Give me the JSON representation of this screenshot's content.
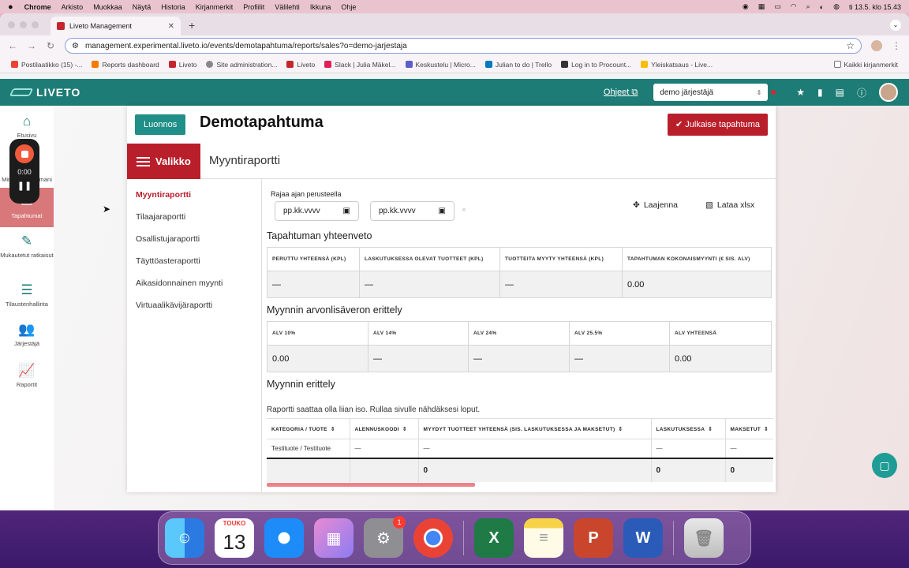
{
  "menubar": {
    "app": "Chrome",
    "items": [
      "Arkisto",
      "Muokkaa",
      "Näytä",
      "Historia",
      "Kirjanmerkit",
      "Profiilit",
      "Välilehti",
      "Ikkuna",
      "Ohje"
    ],
    "clock": "ti 13.5. klo 15.43"
  },
  "browser": {
    "tab_title": "Liveto Management",
    "url": "management.experimental.liveto.io/events/demotapahtuma/reports/sales?o=demo-jarjestaja",
    "bookmarks": [
      "Postilaatikko (15) -...",
      "Reports dashboard",
      "Liveto",
      "Site administration...",
      "Liveto",
      "Slack | Julia Mäkel...",
      "Keskustelu | Micro...",
      "Julian to do | Trello",
      "Log in to Procount...",
      "Yleiskatsaus - Live..."
    ],
    "bookmarks_all": "Kaikki kirjanmerkit"
  },
  "app": {
    "logo": "LIVETO",
    "help": "Ohjeet",
    "org_select": "demo järjestäjä",
    "sidebar": [
      {
        "label": "Etusivu",
        "icon": "home-icon"
      },
      {
        "label": "Minun tapahtumani",
        "icon": "calendar-icon"
      },
      {
        "label": "Tapahtumat",
        "icon": "tickets-icon"
      },
      {
        "label": "Mukautetut ratkaisut",
        "icon": "edit-icon"
      },
      {
        "label": "Tilaustenhallinta",
        "icon": "list-icon"
      },
      {
        "label": "Järjestäjä",
        "icon": "users-icon"
      },
      {
        "label": "Raportit",
        "icon": "chart-icon"
      }
    ],
    "recorder_time": "0:00"
  },
  "event": {
    "status": "Luonnos",
    "title": "Demotapahtuma",
    "publish": "Julkaise tapahtuma",
    "menu_button": "Valikko",
    "report_title": "Myyntiraportti"
  },
  "report_nav": [
    "Myyntiraportti",
    "Tilaajaraportti",
    "Osallistujaraportti",
    "Täyttöasteraportti",
    "Aikasidonnainen myynti",
    "Virtuaalikävijäraportti"
  ],
  "filters": {
    "label": "Rajaa ajan perusteella",
    "date_placeholder": "pp.kk.vvvv",
    "clear": "×",
    "expand": "Laajenna",
    "download": "Lataa xlsx"
  },
  "summary": {
    "title": "Tapahtuman yhteenveto",
    "headers": [
      "PERUTTU YHTEENSÄ (KPL)",
      "LASKUTUKSESSA OLEVAT TUOTTEET (KPL)",
      "TUOTTEITA MYYTY YHTEENSÄ (KPL)",
      "TAPAHTUMAN KOKONAISMYYNTI (€ SIS. ALV)"
    ],
    "values": [
      "—",
      "—",
      "—",
      "0.00"
    ]
  },
  "vat": {
    "title": "Myynnin arvonlisäveron erittely",
    "headers": [
      "ALV 10%",
      "ALV 14%",
      "ALV 24%",
      "ALV 25.5%",
      "ALV YHTEENSÄ"
    ],
    "values": [
      "0.00",
      "—",
      "—",
      "—",
      "0.00"
    ]
  },
  "sales": {
    "title": "Myynnin erittely",
    "note": "Raportti saattaa olla liian iso. Rullaa sivulle nähdäksesi loput.",
    "headers": [
      "KATEGORIA / TUOTE",
      "ALENNUSKOODI",
      "MYYDYT TUOTTEET YHTEENSÄ (SIS. LASKUTUKSESSA JA MAKSETUT)",
      "LASKUTUKSESSA",
      "MAKSETUT"
    ],
    "row": [
      "Testituote / Testituote",
      "—",
      "—",
      "—",
      "—"
    ],
    "totals": [
      "",
      "",
      "0",
      "0",
      "0"
    ]
  },
  "dock": {
    "calendar_month": "TOUKO",
    "calendar_day": "13",
    "settings_badge": "1"
  }
}
